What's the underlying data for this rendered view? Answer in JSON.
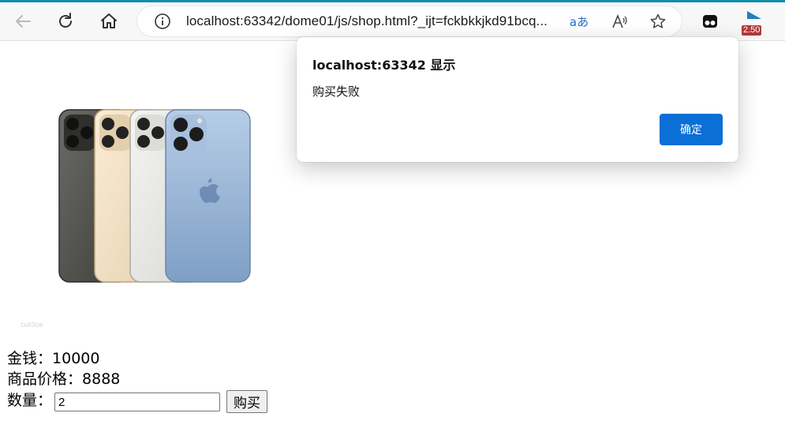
{
  "browser": {
    "url": "localhost:63342/dome01/js/shop.html?_ijt=fckbkkjkd91bcq...",
    "extension_badge": "2.50",
    "icons": [
      "back-icon",
      "refresh-icon",
      "home-icon",
      "info-icon",
      "translate-icon",
      "read-aloud-icon",
      "favorite-star-icon",
      "extension-icon",
      "media-extension-icon"
    ],
    "accent_color": "#0f8ea8"
  },
  "dialog": {
    "title": "localhost:63342 显示",
    "message": "购买失败",
    "ok_label": "确定",
    "button_color": "#0a6fd6"
  },
  "product": {
    "image_alt": "iPhone 13 Pro",
    "money_label": "金钱：",
    "money_value": "10000",
    "price_label": "商品价格：",
    "price_value": "8888",
    "quantity_label": "数量：",
    "quantity_value": "2",
    "buy_label": "购买"
  }
}
